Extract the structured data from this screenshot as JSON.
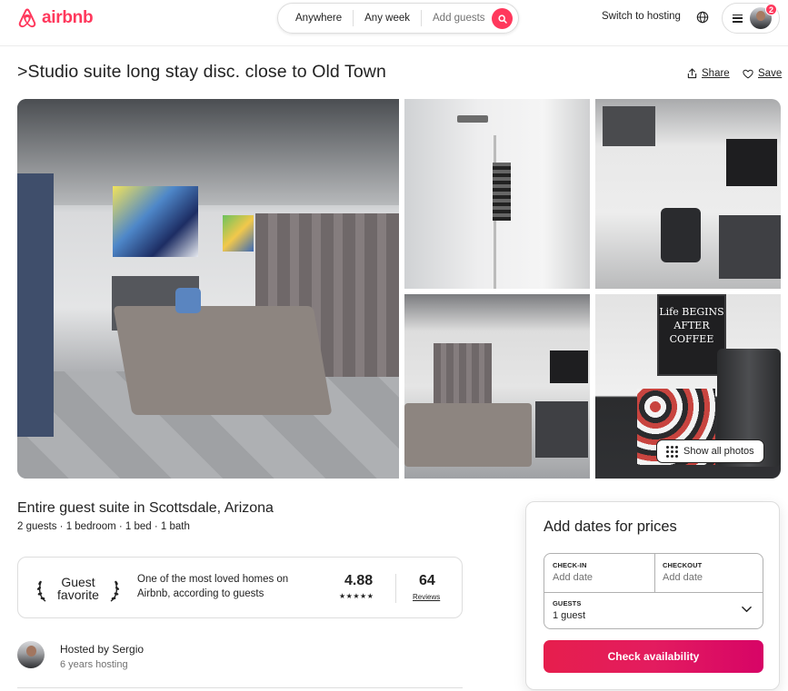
{
  "header": {
    "logo_text": "airbnb",
    "search": {
      "location": "Anywhere",
      "dates": "Any week",
      "guests": "Add guests"
    },
    "switch_to_hosting": "Switch to hosting",
    "notification_count": "2"
  },
  "listing": {
    "title": ">Studio suite long stay disc. close to Old Town",
    "share_label": "Share",
    "save_label": "Save",
    "show_all_photos": "Show all photos",
    "photo_sign_text": "Life BEGINS AFTER COFFEE"
  },
  "details": {
    "subtitle": "Entire guest suite in Scottsdale, Arizona",
    "facts": "2 guests · 1 bedroom · 1 bed · 1 bath",
    "guest_favorite": {
      "line1": "Guest",
      "line2": "favorite",
      "description": "One of the most loved homes on Airbnb, according to guests",
      "rating": "4.88",
      "stars": "★★★★★",
      "review_count": "64",
      "reviews_label": "Reviews"
    },
    "host": {
      "name": "Hosted by Sergio",
      "years": "6 years hosting"
    }
  },
  "booking": {
    "title": "Add dates for prices",
    "checkin_label": "CHECK-IN",
    "checkin_value": "Add date",
    "checkout_label": "CHECKOUT",
    "checkout_value": "Add date",
    "guests_label": "GUESTS",
    "guests_value": "1 guest",
    "button_label": "Check availability"
  },
  "colors": {
    "brand": "#ff385c",
    "button_gradient_start": "#e61e4d",
    "button_gradient_end": "#d70466"
  }
}
